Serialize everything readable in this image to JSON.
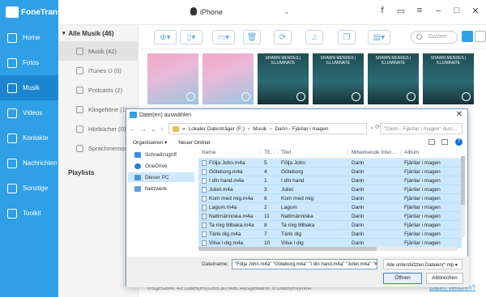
{
  "app": {
    "name": "FoneTrans",
    "device": "iPhone"
  },
  "sidebar": {
    "items": [
      {
        "label": "Home"
      },
      {
        "label": "Fotos"
      },
      {
        "label": "Musik"
      },
      {
        "label": "Videos"
      },
      {
        "label": "Kontakte"
      },
      {
        "label": "Nachrichten"
      },
      {
        "label": "Sonstige"
      },
      {
        "label": "Toolkit"
      }
    ]
  },
  "categories": {
    "header": "Alle Musik (46)",
    "items": [
      {
        "label": "Musik (42)"
      },
      {
        "label": "iTunes U (0)"
      },
      {
        "label": "Podcasts (2)"
      },
      {
        "label": "Klingeltöne (1)"
      },
      {
        "label": "Hörbücher (0)"
      },
      {
        "label": "Sprachmemos"
      }
    ],
    "playlists": "Playlists"
  },
  "toolbar": {
    "search_placeholder": "Suchen"
  },
  "thumbnails": [
    {
      "caption": ""
    },
    {
      "caption": ""
    },
    {
      "caption": "SHAWN MENDES | ILLUMINATE"
    },
    {
      "caption": "SHAWN MENDES | ILLUMINATE"
    },
    {
      "caption": "SHAWN MENDES | ILLUMINATE"
    },
    {
      "caption": "SHAWN MENDES | ILLUMINATE"
    }
  ],
  "status": {
    "text": "Insgesamt: 42 Datei(en)/289.30 MB; Ausgewählt: 0 Datei(en)/N/A",
    "link": "Daten verloren?"
  },
  "dialog": {
    "title": "Datei(en) auswählen",
    "path": [
      "Lokaler Datenträger (F:)",
      "Musik",
      "Darin - Fjärilar i magen"
    ],
    "search_placeholder": "\"Darin - Fjärilar i magen\" durc...",
    "organize": "Organisieren ▾",
    "new_folder": "Neuer Ordner",
    "nav": [
      {
        "label": "Schnellzugriff"
      },
      {
        "label": "OneDrive"
      },
      {
        "label": "Dieser PC"
      },
      {
        "label": "Netzwerk"
      }
    ],
    "columns": {
      "name": "Name",
      "track": "Tit...",
      "title": "Titel",
      "artist": "Mitwirkende Inter...",
      "album": "Album"
    },
    "files": [
      {
        "name": "Följa John.m4a",
        "track": "5",
        "title": "Följa John",
        "artist": "Darin",
        "album": "Fjärilar i magen"
      },
      {
        "name": "Göteborg.m4a",
        "track": "4",
        "title": "Göteborg",
        "artist": "Darin",
        "album": "Fjärilar i magen"
      },
      {
        "name": "I din hand.m4a",
        "track": "1",
        "title": "I din hand",
        "artist": "Darin",
        "album": "Fjärilar i magen"
      },
      {
        "name": "Juliet.m4a",
        "track": "3",
        "title": "Juliet",
        "artist": "Darin",
        "album": "Fjärilar i magen"
      },
      {
        "name": "Kom med mig.m4a",
        "track": "6",
        "title": "Kom med mig",
        "artist": "Darin",
        "album": "Fjärilar i magen"
      },
      {
        "name": "Lagom.m4a",
        "track": "2",
        "title": "Lagom",
        "artist": "Darin",
        "album": "Fjärilar i magen"
      },
      {
        "name": "Nattmänniska.m4a",
        "track": "11",
        "title": "Nattmänniska",
        "artist": "Darin",
        "album": "Fjärilar i magen"
      },
      {
        "name": "Ta mig tillbaka.m4a",
        "track": "8",
        "title": "Ta mig tillbaka",
        "artist": "Darin",
        "album": "Fjärilar i magen"
      },
      {
        "name": "Tänk dig.m4a",
        "track": "7",
        "title": "Tänk dig",
        "artist": "Darin",
        "album": "Fjärilar i magen"
      },
      {
        "name": "Vilse i dig.m4a",
        "track": "10",
        "title": "Vilse i dig",
        "artist": "Darin",
        "album": "Fjärilar i magen"
      }
    ],
    "filename_label": "Dateiname:",
    "filename_value": "\"Följa John.m4a\" \"Göteborg.m4a\" \"I din hand.m4a\" \"Juliet.m4a\" \"Kom m",
    "filetype": "Alle unterstützten Dateien(*.mp ▾",
    "open": "Öffnen",
    "cancel": "Abbrechen"
  }
}
